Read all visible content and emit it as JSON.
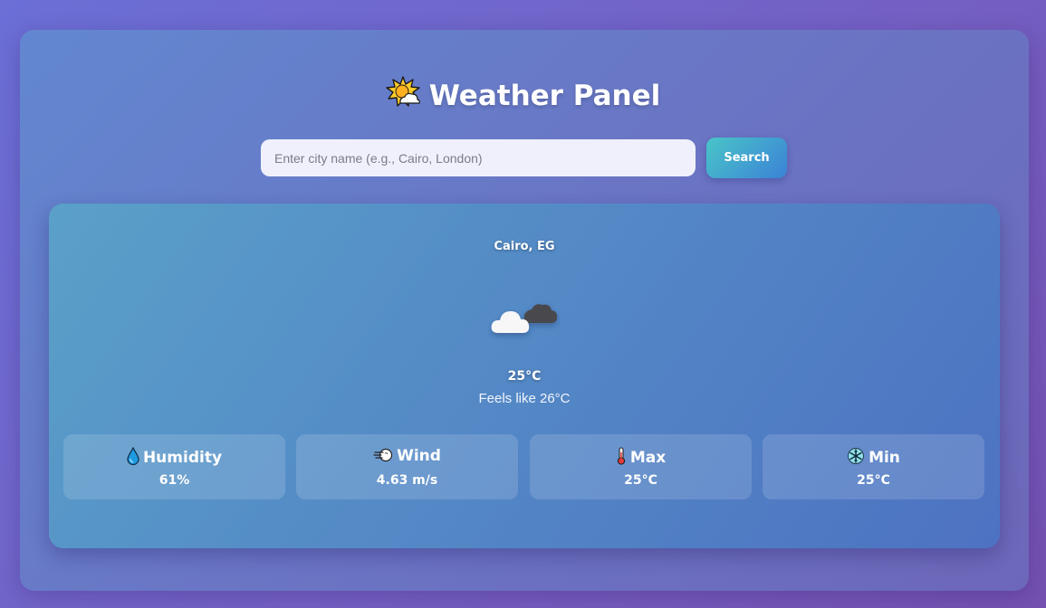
{
  "header": {
    "icon": "sun-behind-cloud-icon",
    "title": "Weather Panel"
  },
  "search": {
    "placeholder": "Enter city name (e.g., Cairo, London)",
    "value": "",
    "button_label": "Search"
  },
  "weather": {
    "location": "Cairo, EG",
    "condition_icon": "cloud-icon",
    "temperature": "25°C",
    "feels_like": "Feels like 26°C",
    "stats": [
      {
        "icon": "droplet-icon",
        "label": "Humidity",
        "value": "61%"
      },
      {
        "icon": "wind-icon",
        "label": "Wind",
        "value": "4.63 m/s"
      },
      {
        "icon": "thermometer-icon",
        "label": "Max",
        "value": "25°C"
      },
      {
        "icon": "snowflake-icon",
        "label": "Min",
        "value": "25°C"
      }
    ]
  },
  "colors": {
    "page_background": "#7163c9",
    "panel_background": "#6a7ac6",
    "card_background": "#548ac6",
    "search_button_start": "#49c5c8",
    "search_button_end": "#3b82d6",
    "text": "#ffffff"
  }
}
